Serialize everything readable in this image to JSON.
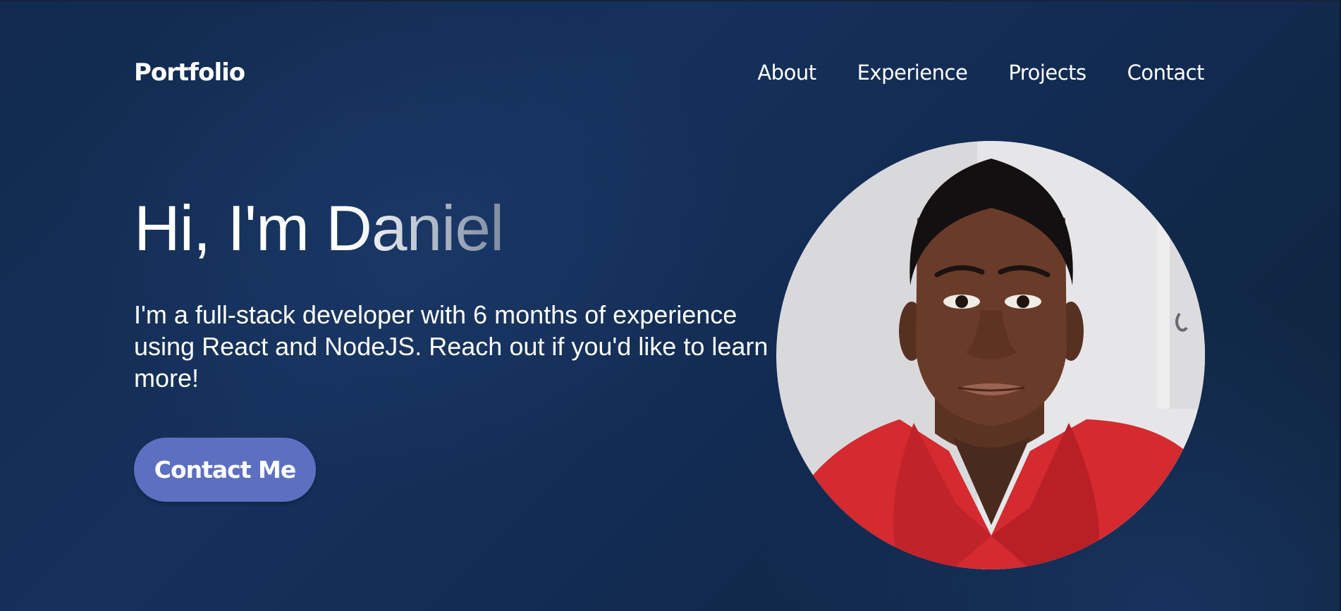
{
  "navbar": {
    "brand": "Portfolio",
    "links": [
      {
        "label": "About"
      },
      {
        "label": "Experience"
      },
      {
        "label": "Projects"
      },
      {
        "label": "Contact"
      }
    ]
  },
  "hero": {
    "greeting": "Hi, I'm Daniel",
    "bio": "I'm a full-stack developer with 6 months of experience using React and NodeJS. Reach out if you'd like to learn more!",
    "cta_label": "Contact Me"
  },
  "colors": {
    "background": "#15315c",
    "accent_button": "#5d6fc0",
    "text": "#ffffff"
  }
}
